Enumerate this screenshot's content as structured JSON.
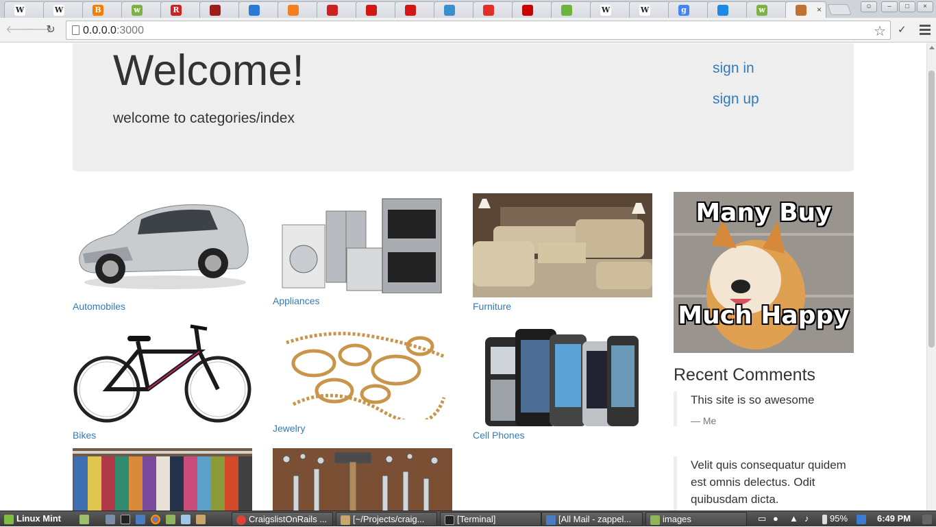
{
  "browser": {
    "tabs": [
      {
        "icon": "wikipedia-icon",
        "glyph": "W",
        "color": "#333333"
      },
      {
        "icon": "wikipedia-icon",
        "glyph": "W",
        "color": "#333333"
      },
      {
        "icon": "blogger-icon",
        "glyph": "B",
        "color": "#f57d00"
      },
      {
        "icon": "webcam-icon",
        "glyph": "w",
        "color": "#7cb342"
      },
      {
        "icon": "rt-icon",
        "glyph": "R",
        "color": "#cc2222"
      },
      {
        "icon": "shield-icon",
        "glyph": "",
        "color": "#a01c1c"
      },
      {
        "icon": "bookmark-icon",
        "glyph": "",
        "color": "#2b7bd6"
      },
      {
        "icon": "stackoverflow-icon",
        "glyph": "",
        "color": "#f48024"
      },
      {
        "icon": "book-icon",
        "glyph": "",
        "color": "#cc2222"
      },
      {
        "icon": "ruby-icon",
        "glyph": "",
        "color": "#d31717"
      },
      {
        "icon": "ruby-icon",
        "glyph": "",
        "color": "#d31717"
      },
      {
        "icon": "cloud-icon",
        "glyph": "",
        "color": "#3a8fd0"
      },
      {
        "icon": "thumbsup-icon",
        "glyph": "",
        "color": "#e52d27"
      },
      {
        "icon": "youtube-icon",
        "glyph": "",
        "color": "#cc0000"
      },
      {
        "icon": "spring-icon",
        "glyph": "",
        "color": "#6db33f"
      },
      {
        "icon": "wikipedia-icon",
        "glyph": "W",
        "color": "#333333"
      },
      {
        "icon": "wikipedia-icon",
        "glyph": "W",
        "color": "#333333"
      },
      {
        "icon": "google-icon",
        "glyph": "g",
        "color": "#4285f4"
      },
      {
        "icon": "dots-icon",
        "glyph": "",
        "color": "#1e88e5"
      },
      {
        "icon": "webcam-icon",
        "glyph": "w",
        "color": "#7cb342"
      },
      {
        "icon": "food-icon",
        "glyph": "",
        "color": "#c07030"
      }
    ],
    "url_host": "0.0.0.0",
    "url_port": ":3000"
  },
  "page": {
    "welcome_title": "Welcome!",
    "welcome_lead": "welcome to categories/index",
    "sign_in": "sign in",
    "sign_up": "sign up",
    "categories": [
      {
        "label": "Automobiles"
      },
      {
        "label": "Appliances"
      },
      {
        "label": "Furniture"
      },
      {
        "label": "Bikes"
      },
      {
        "label": "Jewelry"
      },
      {
        "label": "Cell Phones"
      },
      {
        "label": "",
        "image": "clothing"
      },
      {
        "label": "",
        "image": "tools"
      }
    ],
    "meme": {
      "top": "Many Buy",
      "bottom": "Much Happy"
    },
    "recent_comments_title": "Recent Comments",
    "comments": [
      {
        "text": "This site is so awesome",
        "author": "— Me"
      },
      {
        "text": "Velit quis consequatur quidem est omnis delectus. Odit quibusdam dicta.",
        "author": ""
      }
    ]
  },
  "taskbar": {
    "start_label": "Linux Mint",
    "windows": [
      {
        "label": "CraigslistOnRails ..."
      },
      {
        "label": "[~/Projects/craig..."
      },
      {
        "label": "[Terminal]"
      },
      {
        "label": "[All Mail - zappel..."
      },
      {
        "label": "images"
      }
    ],
    "battery": "95%",
    "clock": "6:49 PM"
  }
}
